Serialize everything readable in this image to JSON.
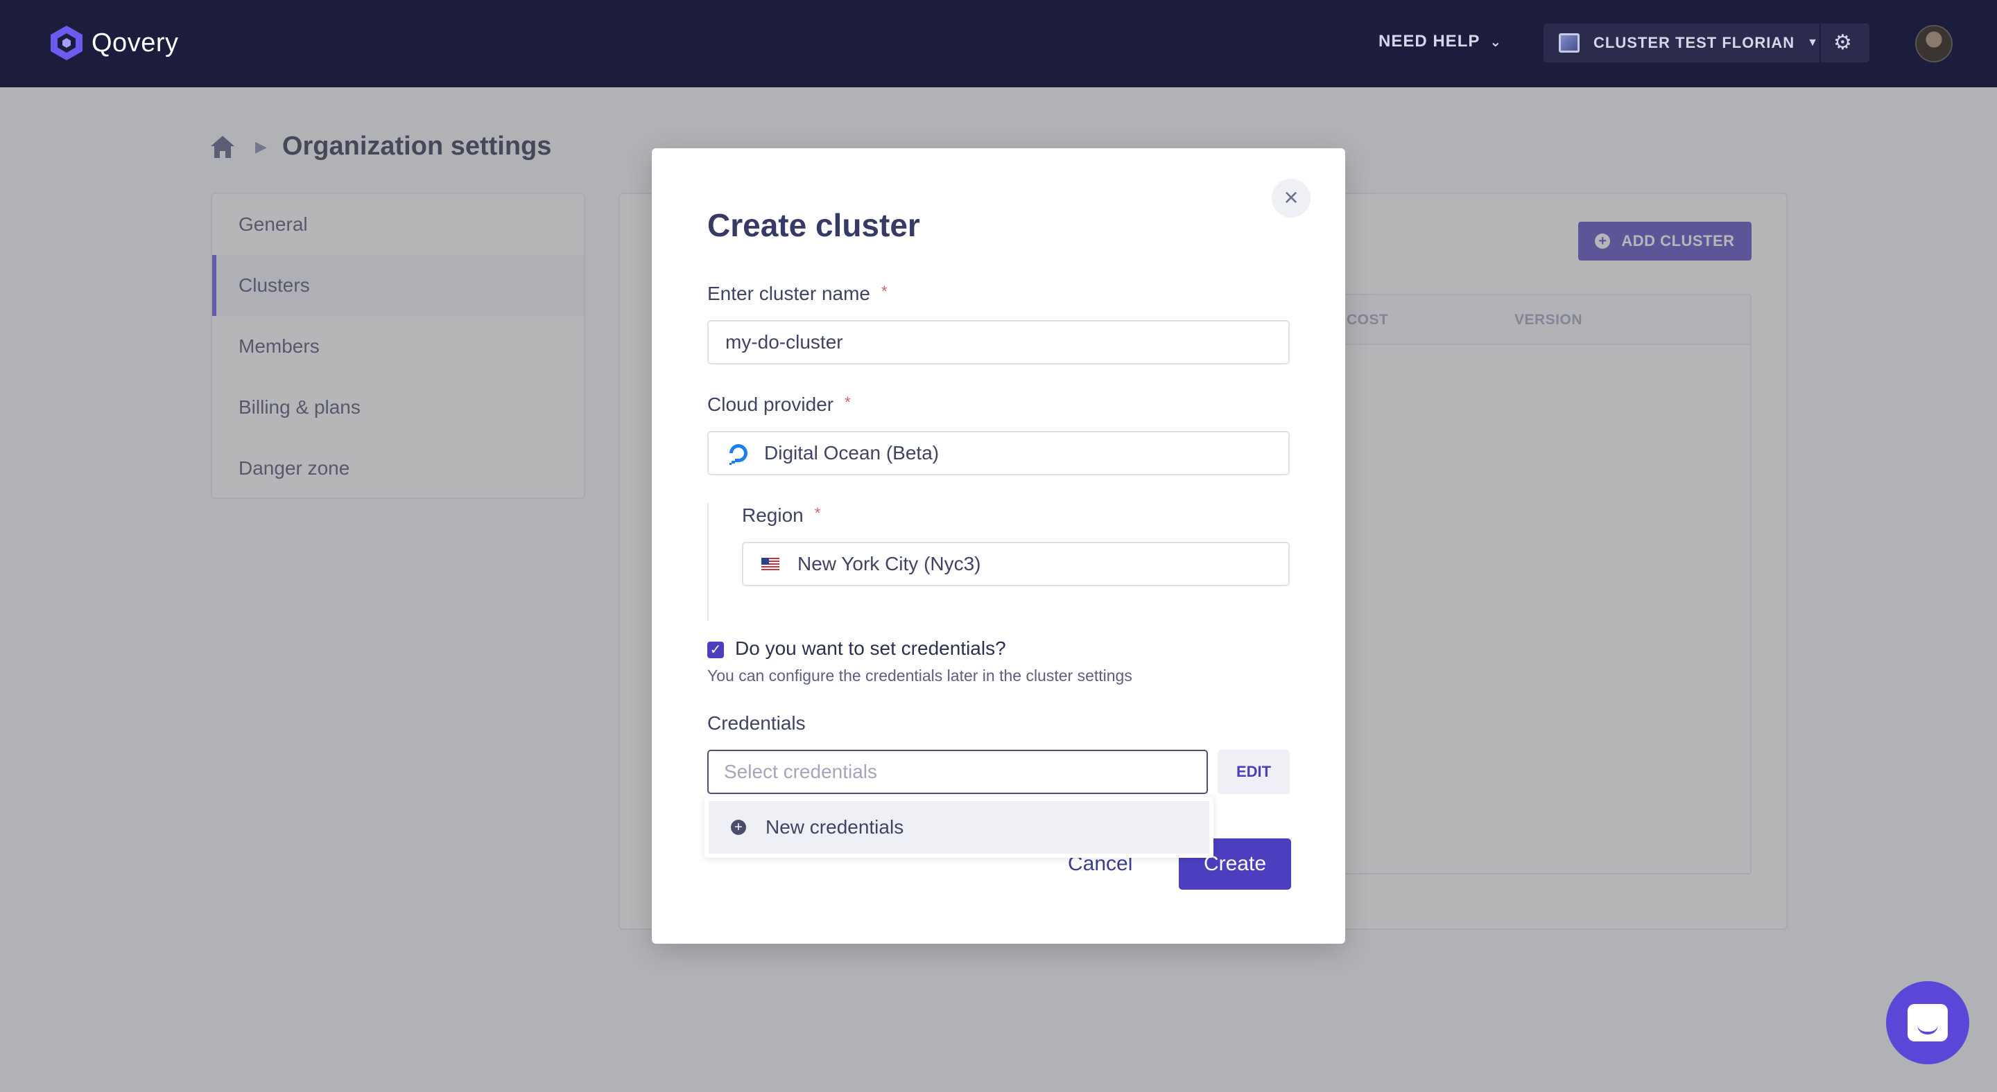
{
  "topbar": {
    "logo_text": "Qovery",
    "need_help": "NEED HELP",
    "cluster_selector": "CLUSTER TEST FLORIAN"
  },
  "breadcrumb": {
    "title": "Organization settings"
  },
  "sidebar": {
    "items": [
      {
        "label": "General"
      },
      {
        "label": "Clusters"
      },
      {
        "label": "Members"
      },
      {
        "label": "Billing & plans"
      },
      {
        "label": "Danger zone"
      }
    ]
  },
  "clusters_page": {
    "add_button": "ADD CLUSTER",
    "columns": [
      "COST",
      "VERSION"
    ]
  },
  "modal": {
    "title": "Create cluster",
    "name_label": "Enter cluster name",
    "name_value": "my-do-cluster",
    "provider_label": "Cloud provider",
    "provider_value": "Digital Ocean (Beta)",
    "region_label": "Region",
    "region_value": "New York City (Nyc3)",
    "credentials_checkbox_label": "Do you want to set credentials?",
    "credentials_help": "You can configure the credentials later in the cluster settings",
    "credentials_label": "Credentials",
    "credentials_placeholder": "Select credentials",
    "edit_button": "EDIT",
    "dropdown_option": "New credentials",
    "cancel_button": "Cancel",
    "create_button": "Create",
    "required_mark": "*"
  },
  "colors": {
    "topbar_bg": "#1c1c3c",
    "primary": "#4b3fbf",
    "required": "#e35b5b"
  },
  "icons": [
    "qovery-logo-icon",
    "chevron-down-icon",
    "cluster-icon",
    "caret-down-icon",
    "gear-icon",
    "avatar",
    "home-icon",
    "chevron-right-icon",
    "plus-circle-icon",
    "close-icon",
    "digital-ocean-icon",
    "us-flag-icon",
    "check-icon",
    "chat-icon"
  ]
}
